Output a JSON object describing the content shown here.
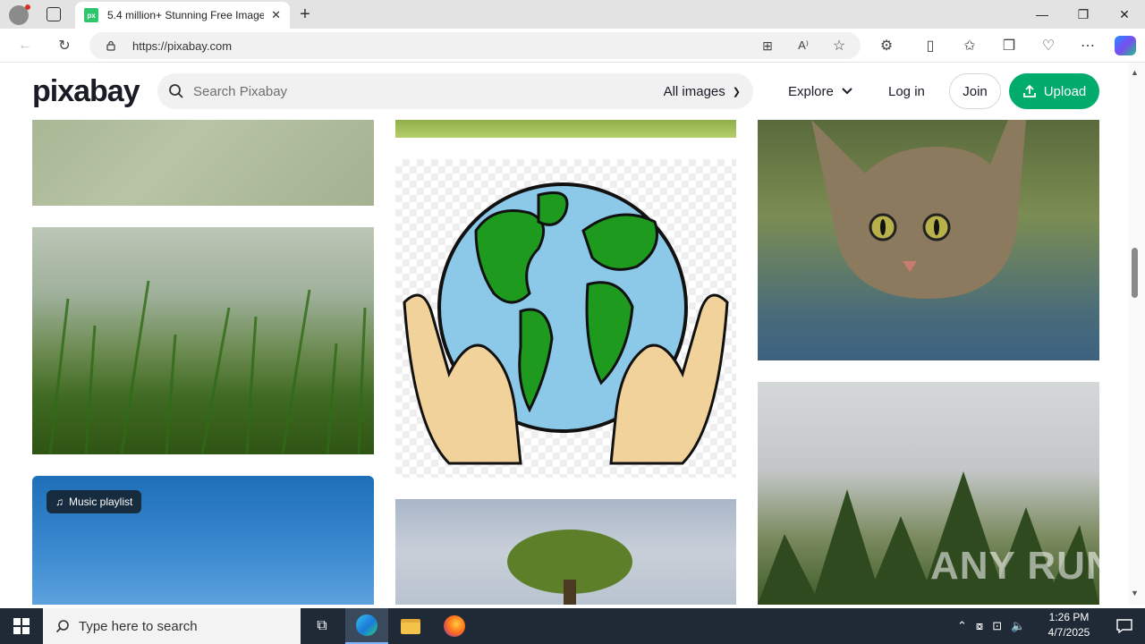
{
  "browser": {
    "tab_title": "5.4 million+ Stunning Free Image",
    "tab_favicon_text": "px",
    "url": "https://pixabay.com",
    "window_controls": [
      "minimize",
      "restore",
      "close"
    ]
  },
  "header": {
    "logo": "pixabay",
    "search_placeholder": "Search Pixabay",
    "filter_label": "All images",
    "explore_label": "Explore",
    "login_label": "Log in",
    "join_label": "Join",
    "upload_label": "Upload"
  },
  "gallery": {
    "badge_label": "Music playlist",
    "watermark": "ANY RUN"
  },
  "taskbar": {
    "search_placeholder": "Type here to search",
    "time": "1:26 PM",
    "date": "4/7/2025"
  },
  "colors": {
    "brand_green": "#00ab6b",
    "taskbar_bg": "#1f2a36"
  }
}
